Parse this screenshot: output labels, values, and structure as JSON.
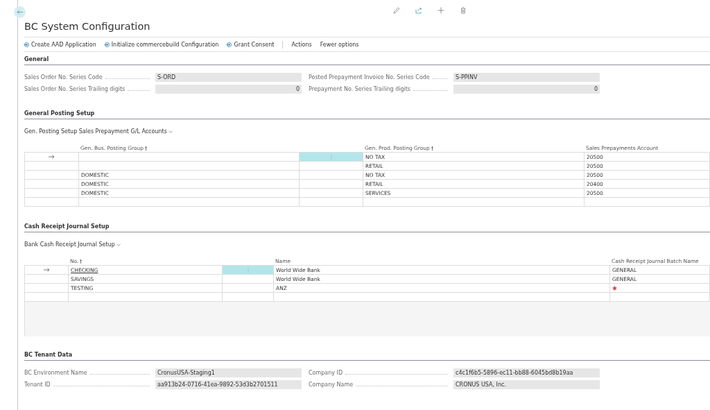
{
  "title": "BC System Configuration",
  "actions": [
    {
      "label": "Create AAD Application",
      "kind": "action"
    },
    {
      "label": "Initialize commercebuild Configuration",
      "kind": "action"
    },
    {
      "label": "Grant Consent",
      "kind": "action"
    },
    {
      "label": "Actions",
      "kind": "menu"
    },
    {
      "label": "Fewer options",
      "kind": "menu"
    }
  ],
  "general": {
    "title": "General",
    "fields": [
      {
        "label": "Sales Order No. Series Code",
        "value": "S-ORD",
        "kind": "text"
      },
      {
        "label": "Posted Prepayment Invoice No. Series Code",
        "value": "S-PPINV",
        "kind": "text"
      },
      {
        "label": "Sales Order No. Series Trailing digits",
        "value": "0",
        "kind": "number"
      },
      {
        "label": "Prepayment No. Series Trailing digits",
        "value": "0",
        "kind": "number"
      }
    ]
  },
  "subpages": [
    {
      "title": "General Posting Setup",
      "part_title": "Gen. Posting Setup Sales Prepayment G/L Accounts",
      "columns": [
        {
          "label": "Gen. Bus. Posting Group",
          "sorted": true
        },
        {
          "label": "Gen. Prod. Posting Group",
          "sorted": true
        },
        {
          "label": "Sales Prepayments Account",
          "sorted": false
        }
      ],
      "rows": [
        {
          "selected": true,
          "cells": [
            {
              "text": ""
            },
            {
              "text": "NO TAX"
            },
            {
              "text": "20500"
            }
          ]
        },
        {
          "selected": false,
          "cells": [
            {
              "text": ""
            },
            {
              "text": "RETAIL"
            },
            {
              "text": "20500"
            }
          ]
        },
        {
          "selected": false,
          "cells": [
            {
              "text": "DOMESTIC"
            },
            {
              "text": "NO TAX"
            },
            {
              "text": "20500"
            }
          ]
        },
        {
          "selected": false,
          "cells": [
            {
              "text": "DOMESTIC"
            },
            {
              "text": "RETAIL"
            },
            {
              "text": "20400"
            }
          ]
        },
        {
          "selected": false,
          "cells": [
            {
              "text": "DOMESTIC"
            },
            {
              "text": "SERVICES"
            },
            {
              "text": "20500"
            }
          ]
        },
        {
          "selected": false,
          "cells": [
            {
              "text": ""
            },
            {
              "text": ""
            },
            {
              "text": ""
            }
          ]
        }
      ]
    },
    {
      "title": "Cash Receipt Journal Setup",
      "part_title": "Bank Cash Receipt Journal Setup",
      "columns": [
        {
          "label": "No.",
          "sorted": true
        },
        {
          "label": "Name",
          "sorted": false
        },
        {
          "label": "Cash Receipt Journal Batch Name",
          "sorted": false
        }
      ],
      "rows": [
        {
          "selected": true,
          "cells": [
            {
              "text": "CHECKING"
            },
            {
              "text": "World Wide Bank"
            },
            {
              "text": "GENERAL"
            }
          ]
        },
        {
          "selected": false,
          "cells": [
            {
              "text": "SAVINGS"
            },
            {
              "text": "World Wide Bank"
            },
            {
              "text": "GENERAL"
            }
          ]
        },
        {
          "selected": false,
          "cells": [
            {
              "text": "TESTING"
            },
            {
              "text": "ANZ"
            },
            {
              "text": "",
              "kind": "required"
            }
          ]
        },
        {
          "selected": false,
          "cells": [
            {
              "text": ""
            },
            {
              "text": ""
            },
            {
              "text": ""
            }
          ]
        }
      ]
    }
  ],
  "tenant": {
    "title": "BC Tenant Data",
    "fields": [
      {
        "label": "BC Environment Name",
        "value": "CronusUSA-Staging1"
      },
      {
        "label": "Company ID",
        "value": "c4c1f6b5-5896-ec11-bb88-6045bd8b19aa"
      },
      {
        "label": "Tenant ID",
        "value": "aa913b24-0716-41ea-9892-53d3b2701511"
      },
      {
        "label": "Company Name",
        "value": "CRONUS USA, Inc."
      }
    ]
  }
}
